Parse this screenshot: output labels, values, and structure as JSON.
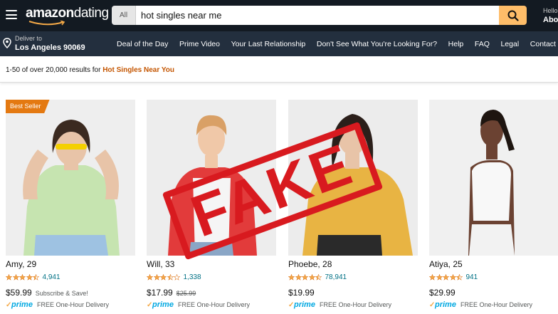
{
  "header": {
    "logo_main": "amazon",
    "logo_suffix": "dating",
    "search": {
      "category": "All",
      "query": "hot singles near me"
    },
    "account_greeting": "Hello",
    "account_name": "Abo"
  },
  "navbar": {
    "deliver_label": "Deliver to",
    "deliver_location": "Los Angeles 90069",
    "links": [
      "Deal of the Day",
      "Prime Video",
      "Your Last Relationship",
      "Don't See What You're Looking For?",
      "Help",
      "FAQ",
      "Legal",
      "Contact"
    ]
  },
  "results": {
    "summary": "1-50 of over 20,000 results for",
    "query_label": "Hot Singles Near You"
  },
  "stamp_text": "FAKE",
  "products": [
    {
      "name": "Amy, 29",
      "badge": "Best Seller",
      "rating": 4.5,
      "reviews": "4,941",
      "price": "$59.99",
      "old_price": "",
      "note": "Subscribe & Save!",
      "prime": "prime",
      "delivery": "FREE One-Hour Delivery"
    },
    {
      "name": "Will, 33",
      "badge": "",
      "rating": 3.5,
      "reviews": "1,338",
      "price": "$17.99",
      "old_price": "$25.99",
      "note": "",
      "prime": "prime",
      "delivery": "FREE One-Hour Delivery"
    },
    {
      "name": "Phoebe, 28",
      "badge": "",
      "rating": 4.5,
      "reviews": "78,941",
      "price": "$19.99",
      "old_price": "",
      "note": "",
      "prime": "prime",
      "delivery": "FREE One-Hour Delivery"
    },
    {
      "name": "Atiya, 25",
      "badge": "",
      "rating": 4.5,
      "reviews": "941",
      "price": "$29.99",
      "old_price": "",
      "note": "",
      "prime": "prime",
      "delivery": "FREE One-Hour Delivery"
    }
  ],
  "colors": {
    "topbar": "#131a22",
    "navbar": "#232f3e",
    "search_button": "#febd69",
    "badge": "#e47911",
    "star": "#f3a847",
    "link": "#007185",
    "prime": "#00a8e1",
    "stamp": "#d81a1f"
  }
}
